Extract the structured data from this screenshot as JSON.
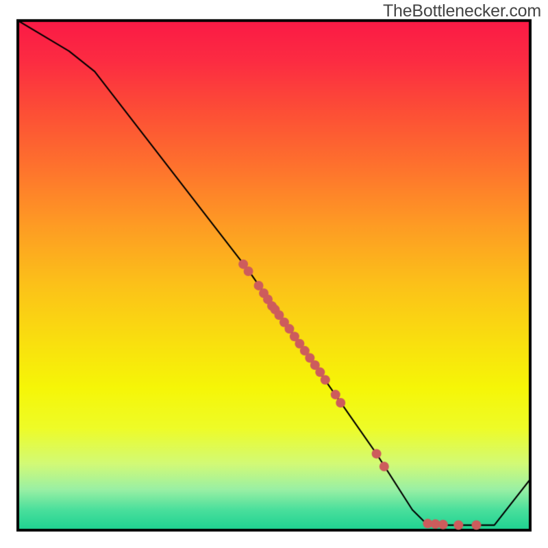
{
  "watermark": "TheBottlenecker.com",
  "chart_data": {
    "type": "line",
    "title": "",
    "xlabel": "",
    "ylabel": "",
    "xlim": [
      0,
      100
    ],
    "ylim": [
      0,
      100
    ],
    "curve": [
      {
        "x": 0,
        "y": 100
      },
      {
        "x": 10,
        "y": 94
      },
      {
        "x": 15,
        "y": 90
      },
      {
        "x": 45,
        "y": 51
      },
      {
        "x": 70,
        "y": 15
      },
      {
        "x": 77,
        "y": 4
      },
      {
        "x": 80,
        "y": 1
      },
      {
        "x": 93,
        "y": 1
      },
      {
        "x": 100,
        "y": 10
      }
    ],
    "points": [
      {
        "x": 44.0,
        "y": 52.2
      },
      {
        "x": 45.0,
        "y": 50.8
      },
      {
        "x": 47.0,
        "y": 48.0
      },
      {
        "x": 48.0,
        "y": 46.5
      },
      {
        "x": 48.8,
        "y": 45.3
      },
      {
        "x": 49.6,
        "y": 44.0
      },
      {
        "x": 50.2,
        "y": 43.3
      },
      {
        "x": 51.0,
        "y": 42.2
      },
      {
        "x": 52.0,
        "y": 40.8
      },
      {
        "x": 53.0,
        "y": 39.5
      },
      {
        "x": 54.0,
        "y": 38.0
      },
      {
        "x": 55.0,
        "y": 36.6
      },
      {
        "x": 56.0,
        "y": 35.2
      },
      {
        "x": 57.0,
        "y": 33.8
      },
      {
        "x": 58.0,
        "y": 32.4
      },
      {
        "x": 59.0,
        "y": 31.0
      },
      {
        "x": 60.0,
        "y": 29.5
      },
      {
        "x": 62.0,
        "y": 26.6
      },
      {
        "x": 63.0,
        "y": 25.0
      },
      {
        "x": 70.0,
        "y": 15.0
      },
      {
        "x": 71.5,
        "y": 12.5
      },
      {
        "x": 80.0,
        "y": 1.3
      },
      {
        "x": 81.5,
        "y": 1.2
      },
      {
        "x": 83.0,
        "y": 1.1
      },
      {
        "x": 86.0,
        "y": 1.0
      },
      {
        "x": 89.5,
        "y": 1.0
      }
    ]
  },
  "style": {
    "plot_margin_x": 26,
    "plot_margin_top": 30,
    "plot_margin_bottom": 26,
    "frame_color": "#000000",
    "frame_width": 4,
    "line_color": "#000000",
    "line_width": 2.2,
    "point_fill": "#cd5c5c",
    "point_radius": 7,
    "gradient_stops": [
      {
        "t": 0.0,
        "c": "#fb1a46"
      },
      {
        "t": 0.08,
        "c": "#fc2c42"
      },
      {
        "t": 0.18,
        "c": "#fd4f36"
      },
      {
        "t": 0.28,
        "c": "#fe702e"
      },
      {
        "t": 0.4,
        "c": "#fe9b24"
      },
      {
        "t": 0.52,
        "c": "#fcc219"
      },
      {
        "t": 0.64,
        "c": "#f9e20e"
      },
      {
        "t": 0.72,
        "c": "#f6f607"
      },
      {
        "t": 0.8,
        "c": "#eefc28"
      },
      {
        "t": 0.87,
        "c": "#d2fa77"
      },
      {
        "t": 0.92,
        "c": "#9af0a4"
      },
      {
        "t": 0.96,
        "c": "#4adf9c"
      },
      {
        "t": 1.0,
        "c": "#1dd291"
      }
    ]
  }
}
